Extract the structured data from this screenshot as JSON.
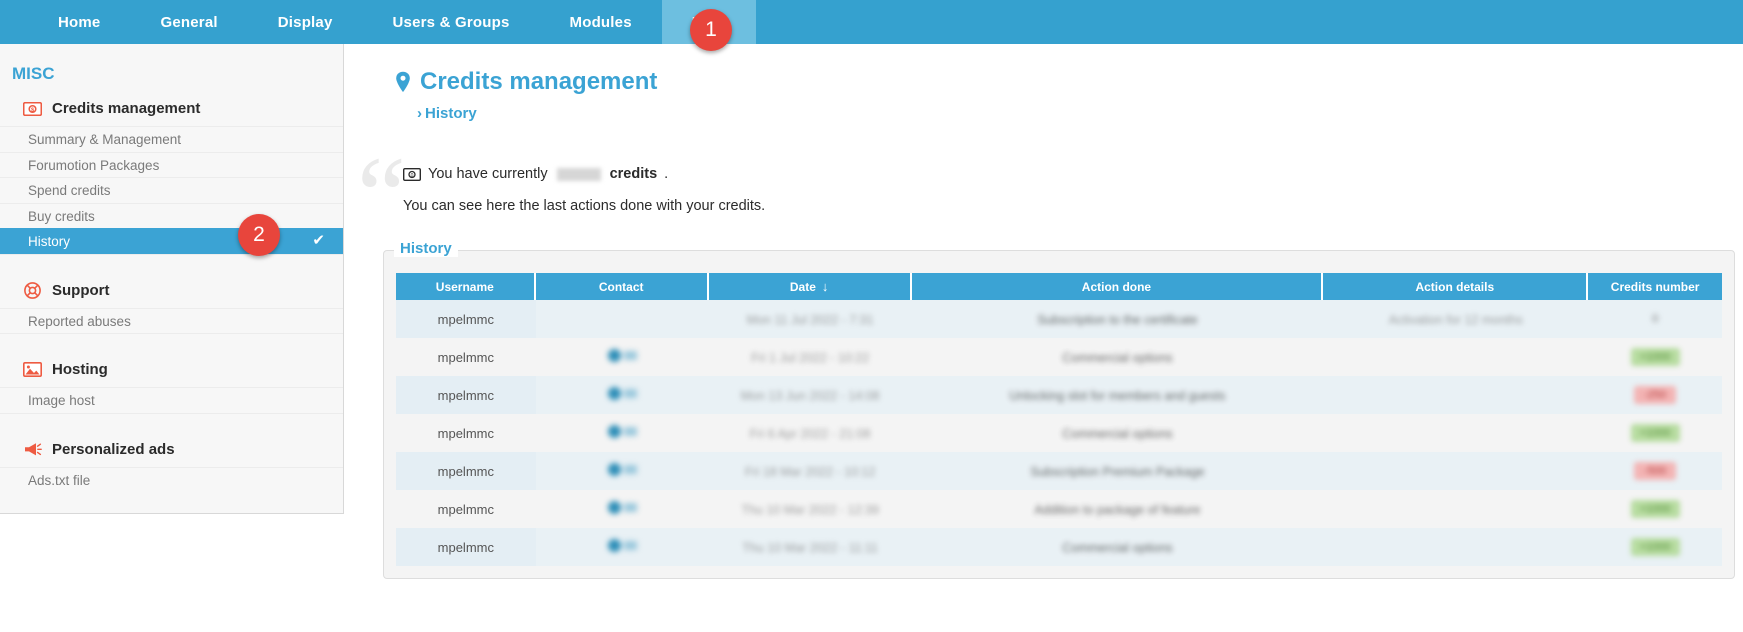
{
  "topnav": {
    "tabs": [
      {
        "label": "Home",
        "active": false
      },
      {
        "label": "General",
        "active": false
      },
      {
        "label": "Display",
        "active": false
      },
      {
        "label": "Users & Groups",
        "active": false
      },
      {
        "label": "Modules",
        "active": false
      },
      {
        "label": "Misc",
        "active": true
      }
    ]
  },
  "badges": {
    "one": "1",
    "two": "2"
  },
  "sidebar": {
    "title": "MISC",
    "groups": [
      {
        "heading": "Credits management",
        "icon": "banknote-icon",
        "items": [
          {
            "label": "Summary & Management",
            "selected": false
          },
          {
            "label": "Forumotion Packages",
            "selected": false
          },
          {
            "label": "Spend credits",
            "selected": false
          },
          {
            "label": "Buy credits",
            "selected": false
          },
          {
            "label": "History",
            "selected": true
          }
        ]
      },
      {
        "heading": "Support",
        "icon": "lifebuoy-icon",
        "items": [
          {
            "label": "Reported abuses",
            "selected": false
          }
        ]
      },
      {
        "heading": "Hosting",
        "icon": "image-icon",
        "items": [
          {
            "label": "Image host",
            "selected": false
          }
        ]
      },
      {
        "heading": "Personalized ads",
        "icon": "megaphone-icon",
        "items": [
          {
            "label": "Ads.txt file",
            "selected": false
          }
        ]
      }
    ],
    "check_glyph": "✔"
  },
  "main": {
    "page_title": "Credits management",
    "title_icon": "map-pin-icon",
    "breadcrumb_chevron": "›",
    "breadcrumb": "History",
    "quote": {
      "open_mark": "“",
      "close_mark": "”",
      "icon": "banknote-icon",
      "line1_before": "You have currently",
      "line1_redacted": "",
      "line1_bold": "credits",
      "line1_after": ".",
      "line2": "You can see here the last actions done with your credits."
    },
    "fieldset_legend": "History",
    "table": {
      "columns": [
        "Username",
        "Contact",
        "Date",
        "Action done",
        "Action details",
        "Credits number"
      ],
      "sorted_column": "Date",
      "sort_arrow": "↓",
      "rows": [
        {
          "username": "mpelmmc",
          "contact": "",
          "date": "Mon 11 Jul 2022 - 7:31",
          "action_done": "Subscription to the certificate",
          "action_details": "Activation for 12 months",
          "credits": "0",
          "credits_sign": "neu"
        },
        {
          "username": "mpelmmc",
          "contact": "contact-avatar",
          "date": "Fri 1 Jul 2022 - 10:22",
          "action_done": "Commercial options",
          "action_details": "",
          "credits": "+1000",
          "credits_sign": "pos"
        },
        {
          "username": "mpelmmc",
          "contact": "contact-avatar",
          "date": "Mon 13 Jun 2022 - 14:08",
          "action_done": "Unlocking slot for members and guests",
          "action_details": "",
          "credits": "-250",
          "credits_sign": "neg"
        },
        {
          "username": "mpelmmc",
          "contact": "contact-avatar",
          "date": "Fri 6 Apr 2022 - 21:08",
          "action_done": "Commercial options",
          "action_details": "",
          "credits": "+1000",
          "credits_sign": "pos"
        },
        {
          "username": "mpelmmc",
          "contact": "contact-avatar",
          "date": "Fri 18 Mar 2022 - 10:12",
          "action_done": "Subscription Premium Package",
          "action_details": "",
          "credits": "-500",
          "credits_sign": "neg"
        },
        {
          "username": "mpelmmc",
          "contact": "contact-avatar",
          "date": "Thu 10 Mar 2022 - 12:39",
          "action_done": "Addition to package of feature",
          "action_details": "",
          "credits": "+1000",
          "credits_sign": "pos"
        },
        {
          "username": "mpelmmc",
          "contact": "contact-avatar",
          "date": "Thu 10 Mar 2022 - 11:11",
          "action_done": "Commercial options",
          "action_details": "",
          "credits": "+1000",
          "credits_sign": "pos"
        }
      ]
    }
  },
  "colors": {
    "nav_blue": "#35a1cf",
    "nav_active_blue": "#6dbfe0",
    "accent_blue": "#3ba3d4",
    "badge_red": "#e8453c",
    "icon_red": "#ee5b42",
    "positive_green": "#b7dca0",
    "negative_red": "#f3b4b4"
  }
}
